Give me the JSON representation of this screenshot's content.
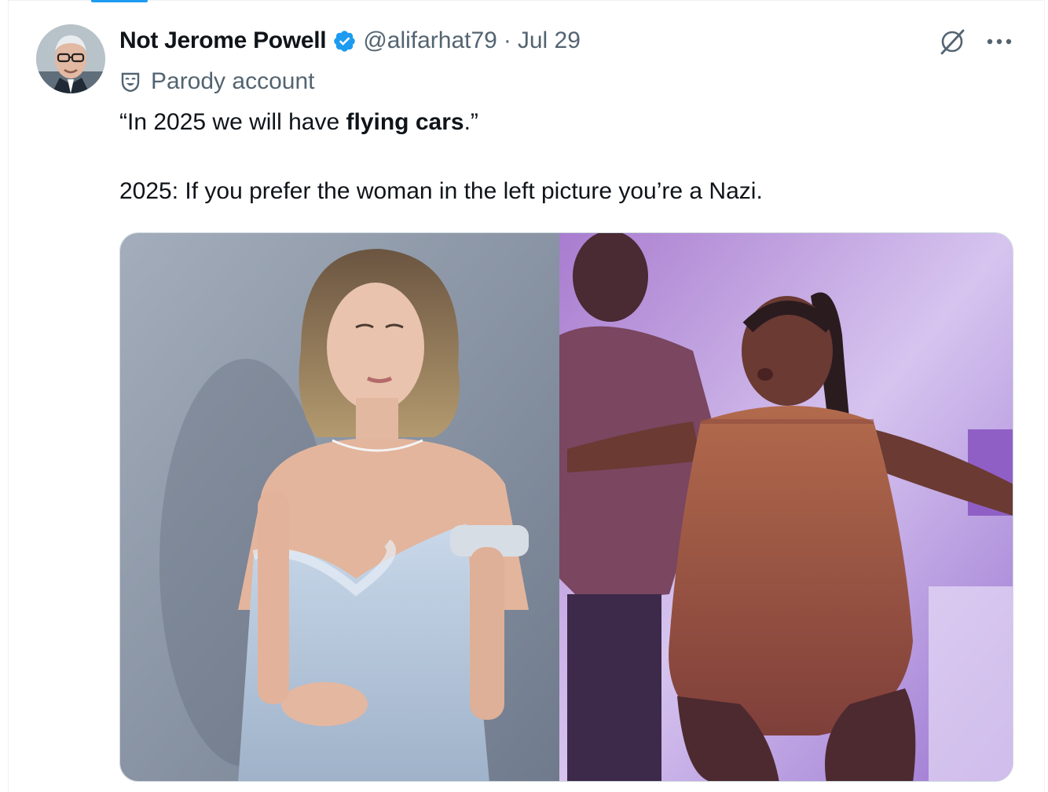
{
  "tweet": {
    "author": {
      "display_name": "Not Jerome Powell",
      "verified": true,
      "handle": "@alifarhat79",
      "separator": "·",
      "date": "Jul 29",
      "label_icon": "parody-mask-icon",
      "label": "Parody account",
      "avatar_icon": "avatar"
    },
    "text": {
      "line1_pre": "“In 2025 we will have ",
      "line1_bold": "flying cars",
      "line1_post": ".”",
      "line2": "2025: If you prefer the woman in the left picture you’re a Nazi."
    },
    "actions": {
      "grok_icon": "grok-icon",
      "more_icon": "more-options-icon"
    },
    "media": {
      "count": 2,
      "images": [
        {
          "name": "left-photo",
          "icon": "photo"
        },
        {
          "name": "right-photo",
          "icon": "photo"
        }
      ]
    }
  },
  "colors": {
    "text_primary": "#0f1419",
    "text_secondary": "#536471",
    "verified_blue": "#1d9bf0",
    "border": "#cfd9de",
    "left_photo_bg": "#8d97a8",
    "right_photo_bg": "#b79be0"
  }
}
